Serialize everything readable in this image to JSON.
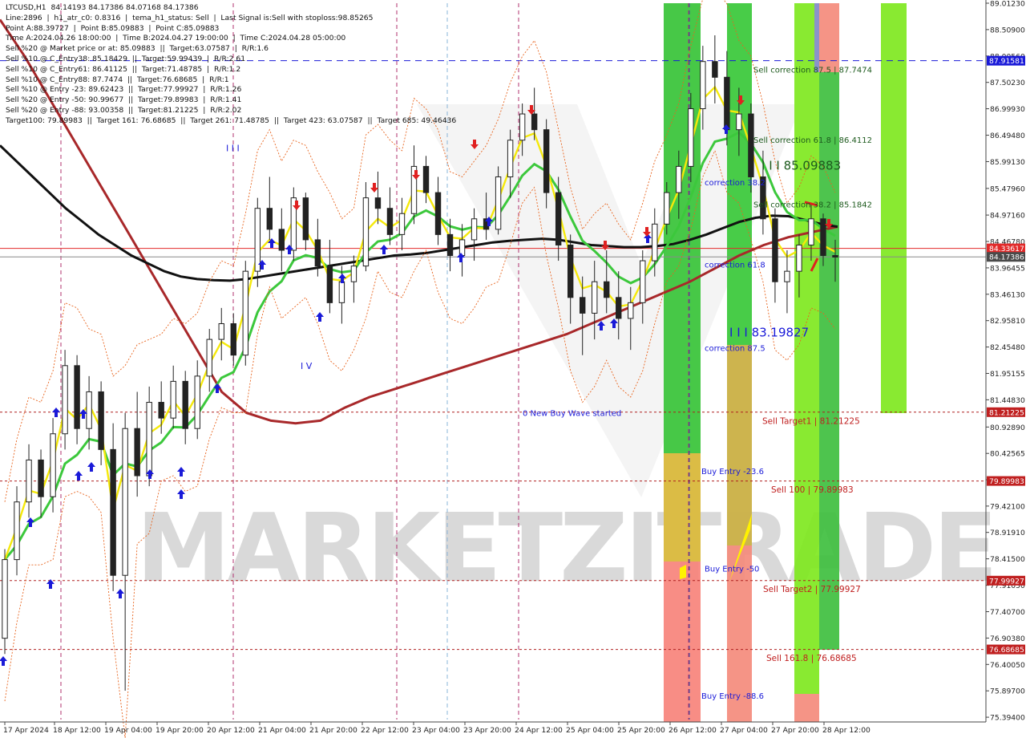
{
  "info_panel": {
    "lines": [
      "LTCUSD,H1  84.14193 84.17386 84.07168 84.17386",
      "Line:2896  |  h1_atr_c0: 0.8316  |  tema_h1_status: Sell  |  Last Signal is:Sell with stoploss:98.85265",
      "Point A:88.39727  |  Point B:85.09883  |  Point C:85.09883",
      "Time A:2024.04.26 18:00:00  |  Time B:2024.04.27 19:00:00  |  Time C:2024.04.28 05:00:00",
      "Sell %20 @ Market price or at: 85.09883  ||  Target:63.07587  |  R/R:1.6",
      "Sell %10 @ C_Entry38: 85.18429  ||  Target:59.99439  |  R/R:2.61",
      "Sell %10 @ C_Entry61: 86.41125  ||  Target:71.48785  |  R/R:1.2",
      "Sell %10 @ C_Entry88: 87.7474  ||  Target:76.68685  |  R/R:1",
      "Sell %10 @ Entry -23: 89.62423  ||  Target:77.99927  |  R/R:1.26",
      "Sell %20 @ Entry -50: 90.99677  ||  Target:79.89983  |  R/R:1.41",
      "Sell %20 @ Entry -88: 93.00358  ||  Target:81.21225  |  R/R:2.02",
      "Target100: 79.89983  ||  Target 161: 76.68685  ||  Target 261: 71.48785  ||  Target 423: 63.07587  ||  Target 685: 49.46436"
    ]
  },
  "chart_data": {
    "type": "candlestick",
    "symbol": "LTCUSD",
    "timeframe": "H1",
    "ylim": [
      75.3494,
      89.0123
    ],
    "y_ticks": [
      "89.01230",
      "88.50900",
      "88.00560",
      "87.50230",
      "86.99930",
      "86.49480",
      "85.99130",
      "85.47960",
      "84.97160",
      "84.46780",
      "83.96455",
      "83.46130",
      "82.95810",
      "82.45480",
      "81.95155",
      "81.44830",
      "80.92890",
      "80.42565",
      "79.92240",
      "79.42100",
      "78.91910",
      "78.41500",
      "77.91050",
      "77.40700",
      "76.90380",
      "76.40050",
      "75.89700",
      "75.39400"
    ],
    "x_labels": [
      "17 Apr 2024",
      "18 Apr 12:00",
      "19 Apr 04:00",
      "19 Apr 20:00",
      "20 Apr 12:00",
      "21 Apr 04:00",
      "21 Apr 20:00",
      "22 Apr 12:00",
      "23 Apr 04:00",
      "23 Apr 20:00",
      "24 Apr 12:00",
      "25 Apr 04:00",
      "25 Apr 20:00",
      "26 Apr 12:00",
      "27 Apr 04:00",
      "27 Apr 20:00",
      "28 Apr 12:00"
    ],
    "price_tags": [
      {
        "value": "87.91581",
        "price": 87.91581,
        "color": "#1a1ad8"
      },
      {
        "value": "84.33617",
        "price": 84.33617,
        "color": "#e22a2a"
      },
      {
        "value": "84.17386",
        "price": 84.17386,
        "color": "#4a4a4a"
      },
      {
        "value": "81.21225",
        "price": 81.21225,
        "color": "#c02020"
      },
      {
        "value": "79.89983",
        "price": 79.89983,
        "color": "#c02020"
      },
      {
        "value": "77.99927",
        "price": 77.99927,
        "color": "#c02020"
      },
      {
        "value": "76.68685",
        "price": 76.68685,
        "color": "#c02020"
      }
    ],
    "annotations": [
      {
        "text": "Sell correction 87.5 | 87.7474",
        "price": 87.75,
        "color": "#1d5a1d"
      },
      {
        "text": "Sell correction 61.8 | 86.4112",
        "price": 86.41,
        "color": "#1d5a1d"
      },
      {
        "text": "Sell correction 38.2 | 85.1842",
        "price": 85.18,
        "color": "#1d5a1d"
      },
      {
        "text": "I I I 85.09883",
        "price": 85.9,
        "color": "#1d5a1d"
      },
      {
        "text": "correction 38.2",
        "price": 85.6,
        "color": "#1a1ad8"
      },
      {
        "text": "correction 61.8",
        "price": 84.03,
        "color": "#1a1ad8"
      },
      {
        "text": "I I I 83.19827",
        "price": 82.72,
        "color": "#1a1ad8"
      },
      {
        "text": "correction 87.5",
        "price": 82.44,
        "color": "#1a1ad8"
      },
      {
        "text": "0 New Buy Wave started",
        "price": 81.2,
        "color": "#1a1ad8"
      },
      {
        "text": "Sell Target1 | 81.21225",
        "price": 81.05,
        "color": "#c02020"
      },
      {
        "text": "Buy Entry -23.6",
        "price": 80.09,
        "color": "#1a1ad8"
      },
      {
        "text": "Sell 100 | 79.89983",
        "price": 79.74,
        "color": "#c02020"
      },
      {
        "text": "Buy Entry -50",
        "price": 78.23,
        "color": "#1a1ad8"
      },
      {
        "text": "Sell Target2 | 77.99927",
        "price": 77.84,
        "color": "#c02020"
      },
      {
        "text": "Sell 161.8 | 76.68685",
        "price": 76.53,
        "color": "#c02020"
      },
      {
        "text": "Buy Entry -88.6",
        "price": 75.81,
        "color": "#1a1ad8"
      },
      {
        "text": "I I I",
        "price": 86.25,
        "color": "#1a1ad8"
      },
      {
        "text": "I V",
        "price": 82.1,
        "color": "#1a1ad8"
      }
    ],
    "watermark": "MARKETZITRADE",
    "series": [
      {
        "name": "candles",
        "values": [
          [
            76.9,
            78.6,
            76.6,
            78.4
          ],
          [
            78.4,
            79.8,
            78.1,
            79.5
          ],
          [
            79.5,
            80.6,
            79.2,
            80.3
          ],
          [
            80.3,
            80.5,
            79.2,
            79.6
          ],
          [
            79.6,
            81.1,
            79.3,
            80.8
          ],
          [
            80.8,
            82.4,
            80.5,
            82.1
          ],
          [
            82.1,
            82.3,
            80.6,
            80.9
          ],
          [
            80.9,
            81.9,
            80.5,
            81.6
          ],
          [
            81.6,
            81.8,
            80.2,
            80.5
          ],
          [
            80.5,
            81.0,
            77.8,
            78.1
          ],
          [
            78.1,
            81.2,
            75.9,
            80.9
          ],
          [
            80.9,
            81.6,
            79.6,
            80.0
          ],
          [
            80.0,
            81.7,
            79.8,
            81.4
          ],
          [
            81.4,
            81.8,
            80.8,
            81.1
          ],
          [
            81.1,
            82.1,
            80.9,
            81.8
          ],
          [
            81.8,
            82.0,
            80.6,
            80.9
          ],
          [
            80.9,
            82.2,
            80.7,
            81.9
          ],
          [
            81.9,
            82.8,
            81.6,
            82.6
          ],
          [
            82.6,
            83.2,
            82.2,
            82.9
          ],
          [
            82.9,
            83.1,
            82.1,
            82.3
          ],
          [
            82.3,
            84.1,
            82.1,
            83.9
          ],
          [
            83.9,
            85.3,
            83.6,
            85.1
          ],
          [
            85.1,
            85.7,
            84.5,
            84.7
          ],
          [
            84.7,
            85.1,
            83.9,
            84.3
          ],
          [
            84.3,
            85.5,
            84.1,
            85.3
          ],
          [
            85.3,
            85.4,
            84.3,
            84.5
          ],
          [
            84.5,
            84.9,
            83.8,
            84.0
          ],
          [
            84.0,
            84.5,
            83.1,
            83.3
          ],
          [
            83.3,
            84.0,
            82.9,
            83.7
          ],
          [
            83.7,
            84.2,
            83.3,
            84.0
          ],
          [
            84.0,
            85.6,
            83.9,
            85.3
          ],
          [
            85.3,
            85.8,
            84.8,
            85.1
          ],
          [
            85.1,
            85.5,
            84.4,
            84.6
          ],
          [
            84.6,
            85.3,
            84.3,
            85.0
          ],
          [
            85.0,
            86.3,
            84.8,
            85.9
          ],
          [
            85.9,
            86.1,
            85.2,
            85.4
          ],
          [
            85.4,
            85.7,
            84.4,
            84.6
          ],
          [
            84.6,
            84.9,
            83.9,
            84.2
          ],
          [
            84.2,
            84.8,
            83.8,
            84.5
          ],
          [
            84.5,
            85.1,
            84.1,
            84.9
          ],
          [
            84.9,
            85.4,
            84.5,
            84.7
          ],
          [
            84.7,
            85.9,
            84.6,
            85.7
          ],
          [
            85.7,
            86.6,
            85.3,
            86.4
          ],
          [
            86.4,
            87.1,
            86.1,
            86.9
          ],
          [
            86.9,
            87.4,
            86.4,
            86.6
          ],
          [
            86.6,
            86.8,
            85.1,
            85.4
          ],
          [
            85.4,
            85.7,
            84.1,
            84.4
          ],
          [
            84.4,
            84.6,
            82.9,
            83.4
          ],
          [
            83.4,
            83.8,
            82.3,
            83.1
          ],
          [
            83.1,
            84.1,
            82.6,
            83.7
          ],
          [
            83.7,
            84.3,
            83.1,
            83.4
          ],
          [
            83.4,
            83.9,
            82.6,
            83.0
          ],
          [
            83.0,
            83.6,
            82.4,
            83.3
          ],
          [
            83.3,
            84.3,
            82.9,
            84.1
          ],
          [
            84.1,
            85.1,
            83.8,
            84.8
          ],
          [
            84.8,
            85.6,
            84.6,
            85.4
          ],
          [
            85.4,
            86.2,
            84.9,
            85.9
          ],
          [
            85.9,
            87.3,
            85.6,
            87.0
          ],
          [
            87.0,
            88.2,
            86.6,
            87.9
          ],
          [
            87.9,
            88.4,
            87.1,
            87.6
          ],
          [
            87.6,
            88.1,
            86.3,
            86.6
          ],
          [
            86.6,
            87.4,
            86.1,
            86.9
          ],
          [
            86.9,
            87.1,
            85.4,
            85.7
          ],
          [
            85.7,
            86.2,
            84.6,
            84.9
          ],
          [
            84.9,
            85.1,
            83.3,
            83.7
          ],
          [
            83.7,
            84.3,
            83.1,
            83.9
          ],
          [
            83.9,
            84.6,
            83.4,
            84.4
          ],
          [
            84.4,
            85.2,
            84.1,
            84.9
          ],
          [
            84.9,
            85.0,
            84.0,
            84.2
          ],
          [
            84.2,
            84.5,
            83.7,
            84.17
          ]
        ]
      },
      {
        "name": "sma_200",
        "values": [
          86.3,
          86.0,
          85.7,
          85.4,
          85.1,
          84.85,
          84.6,
          84.4,
          84.2,
          84.05,
          83.9,
          83.8,
          83.75,
          83.73,
          83.72,
          83.75,
          83.8,
          83.85,
          83.9,
          83.95,
          84.0,
          84.05,
          84.1,
          84.15,
          84.2,
          84.22,
          84.25,
          84.3,
          84.35,
          84.4,
          84.45,
          84.48,
          84.5,
          84.52,
          84.5,
          84.45,
          84.4,
          84.38,
          84.36,
          84.36,
          84.38,
          84.42,
          84.5,
          84.6,
          84.72,
          84.84,
          84.92,
          84.96,
          84.95,
          84.88,
          84.8,
          84.75
        ]
      },
      {
        "name": "sma_500",
        "values": [
          88.7,
          88.0,
          87.2,
          86.4,
          85.6,
          84.8,
          84.0,
          83.2,
          82.4,
          81.6,
          81.2,
          81.05,
          81.0,
          81.05,
          81.3,
          81.5,
          81.65,
          81.8,
          81.95,
          82.1,
          82.25,
          82.4,
          82.55,
          82.7,
          82.9,
          83.1,
          83.3,
          83.5,
          83.7,
          83.95,
          84.2,
          84.4,
          84.55,
          84.65,
          84.75
        ]
      }
    ]
  }
}
